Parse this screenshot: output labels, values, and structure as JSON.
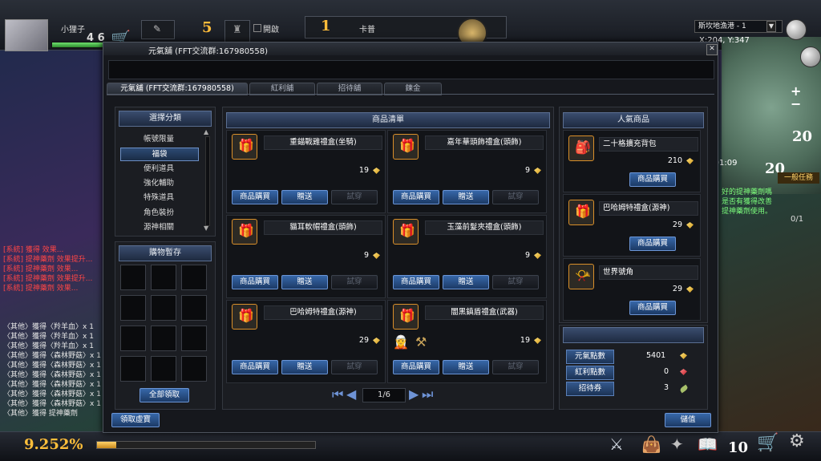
{
  "hud": {
    "player_name": "小狸子",
    "level": "5",
    "player_stat_partial": "4 6",
    "open_label": "開啟",
    "target_level": "1",
    "target_name": "卡普",
    "map_location": "斯坎地漁港 - 1",
    "map_coords": "X:204, Y:347",
    "map_time": "AM 01:09",
    "map_level_1": "20",
    "map_level_2": "20",
    "quest_header": "一般任務",
    "quest_lines": [
      "好的提神藥劑嗎",
      "是否有獲得改善",
      "提神藥劑使用。"
    ],
    "quest_progress": "0/1",
    "exp_percent": "9.252%",
    "exp_fraction": 0.09,
    "bottom_level": "10"
  },
  "chat": {
    "lines_red": [
      "[系統] 獲得 效果...",
      "[系統] 提神藥劑 效果提升...",
      "[系統] 提神藥劑 效果...",
      "[系統] 提神藥劑 效果提升...",
      "[系統] 提神藥劑 效果..."
    ],
    "lines": [
      "〈其他〉獲得〈羚羊血〉x 1",
      "〈其他〉獲得〈羚羊血〉x 1",
      "〈其他〉獲得〈羚羊血〉x 1",
      "〈其他〉獲得〈森林野菇〉x 1",
      "〈其他〉獲得〈森林野菇〉x 1",
      "〈其他〉獲得〈森林野菇〉x 1",
      "〈其他〉獲得〈森林野菇〉x 1",
      "〈其他〉獲得〈森林野菇〉x 1",
      "〈其他〉獲得〈森林野菇〉x 1",
      "〈其他〉獲得 提神藥劑"
    ]
  },
  "shop": {
    "title": "元氣舖 (FFT交流群:167980558)",
    "close_label": "✕",
    "tabs": [
      {
        "label": "元氣舖 (FFT交流群:167980558)",
        "active": true
      },
      {
        "label": "紅利舖",
        "active": false
      },
      {
        "label": "招待舖",
        "active": false
      },
      {
        "label": "鍊金",
        "active": false
      }
    ],
    "category": {
      "header": "選擇分類",
      "items": [
        {
          "label": "帳號限量",
          "active": false
        },
        {
          "label": "福袋",
          "active": true
        },
        {
          "label": "便利道具",
          "active": false
        },
        {
          "label": "強化輔助",
          "active": false
        },
        {
          "label": "特殊道具",
          "active": false
        },
        {
          "label": "角色裝扮",
          "active": false
        },
        {
          "label": "源神相關",
          "active": false
        }
      ]
    },
    "cart": {
      "header": "購物暫存",
      "claim_all_label": "全部領取"
    },
    "claim_gift_label": "領取虛寶",
    "product_list": {
      "header": "商品清單",
      "buy_label": "商品購買",
      "gift_label": "贈送",
      "third_label": "試穿",
      "items": [
        {
          "name": "重錨戰雞禮盒(坐騎)",
          "price": "19",
          "icon": "gift-box-icon"
        },
        {
          "name": "嘉年華頭飾禮盒(頭飾)",
          "price": "9",
          "icon": "gift-box-icon"
        },
        {
          "name": "貓耳軟帽禮盒(頭飾)",
          "price": "9",
          "icon": "gift-box-icon"
        },
        {
          "name": "玉藻前髮夾禮盒(頭飾)",
          "price": "9",
          "icon": "gift-box-icon"
        },
        {
          "name": "巴哈姆特禮盒(源神)",
          "price": "29",
          "icon": "gift-box-icon"
        },
        {
          "name": "闇黑鎮盾禮盒(武器)",
          "price": "19",
          "icon": "gift-box-icon"
        }
      ],
      "page": "1/6"
    },
    "popular": {
      "header": "人氣商品",
      "buy_label": "商品購買",
      "items": [
        {
          "name": "二十格擴充背包",
          "price": "210",
          "icon": "backpack-icon"
        },
        {
          "name": "巴哈姆特禮盒(源神)",
          "price": "29",
          "icon": "gift-box-icon"
        },
        {
          "name": "世界號角",
          "price": "29",
          "icon": "horn-icon"
        }
      ]
    },
    "points": [
      {
        "label": "元氣點數",
        "value": "5401",
        "icon": "gold-gem-icon"
      },
      {
        "label": "紅利點數",
        "value": "0",
        "icon": "red-gem-icon"
      },
      {
        "label": "招待券",
        "value": "3",
        "icon": "leaf-icon"
      }
    ],
    "deposit_label": "儲值"
  }
}
